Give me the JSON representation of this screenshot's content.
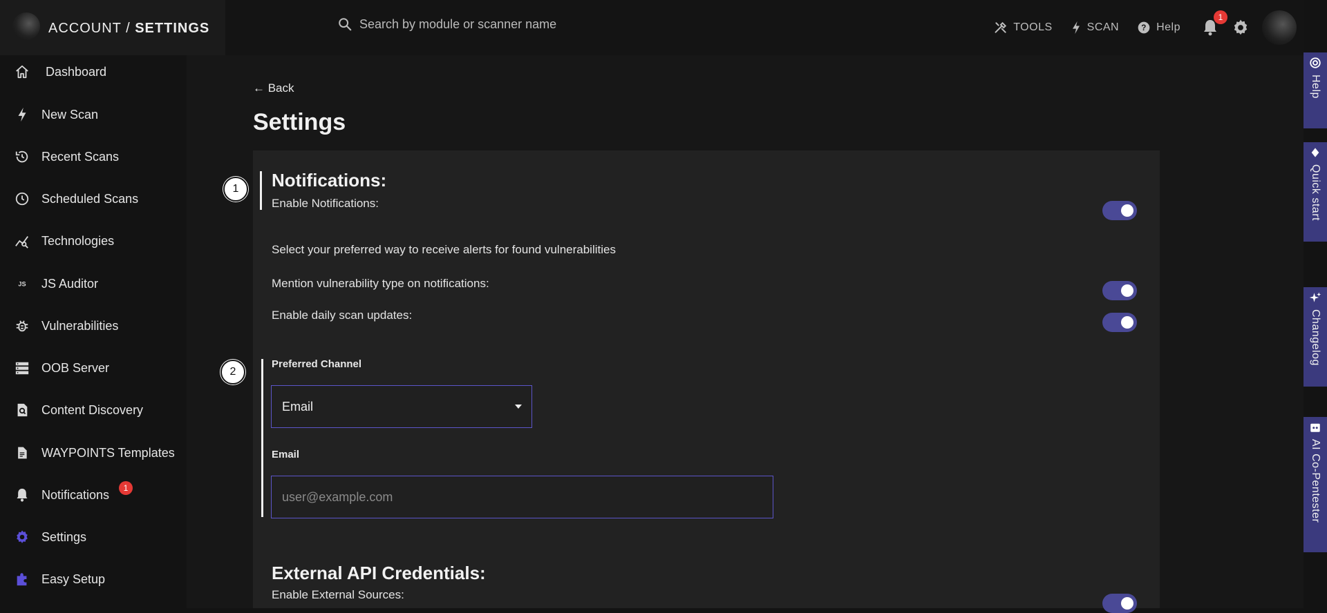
{
  "header": {
    "brand_prefix": "ACCOUNT /",
    "brand_main": "SETTINGS",
    "search_placeholder": "Search by module or scanner name",
    "tools_label": "TOOLS",
    "scan_label": "SCAN",
    "help_label": "Help",
    "notification_count": "1"
  },
  "sidebar": {
    "items": [
      {
        "label": "Dashboard",
        "icon": "home-icon"
      },
      {
        "label": "New Scan",
        "icon": "bolt-icon"
      },
      {
        "label": "Recent Scans",
        "icon": "history-icon"
      },
      {
        "label": "Scheduled Scans",
        "icon": "clock-icon"
      },
      {
        "label": "Technologies",
        "icon": "chart-icon"
      },
      {
        "label": "JS Auditor",
        "icon": "js-icon"
      },
      {
        "label": "Vulnerabilities",
        "icon": "bug-icon"
      },
      {
        "label": "OOB Server",
        "icon": "server-icon"
      },
      {
        "label": "Content Discovery",
        "icon": "doc-search-icon"
      },
      {
        "label": "WAYPOINTS Templates",
        "icon": "file-icon"
      },
      {
        "label": "Notifications",
        "icon": "bell-icon",
        "badge": "1"
      },
      {
        "label": "Settings",
        "icon": "gear-icon",
        "active": true
      },
      {
        "label": "Easy Setup",
        "icon": "puzzle-icon",
        "active": true
      }
    ]
  },
  "main": {
    "back_label": "← Back",
    "title": "Settings",
    "notifications": {
      "step": "1",
      "heading": "Notifications:",
      "enable_label": "Enable Notifications:",
      "description": "Select your preferred way to receive alerts for found vulnerabilities",
      "mention_label": "Mention vulnerability type on notifications:",
      "daily_label": "Enable daily scan updates:"
    },
    "channel": {
      "step": "2",
      "label": "Preferred Channel",
      "selected": "Email",
      "email_label": "Email",
      "email_placeholder": "user@example.com"
    },
    "external": {
      "heading": "External API Credentials:",
      "enable_label": "Enable External Sources:"
    }
  },
  "rail": {
    "help": "Help",
    "quickstart": "Quick start",
    "changelog": "Changelog",
    "ai": "AI Co-Pentester"
  },
  "colors": {
    "accent": "#4a4996",
    "accent_border": "#5c55c9",
    "badge": "#e53935",
    "active_icon": "#5b4fd8"
  }
}
